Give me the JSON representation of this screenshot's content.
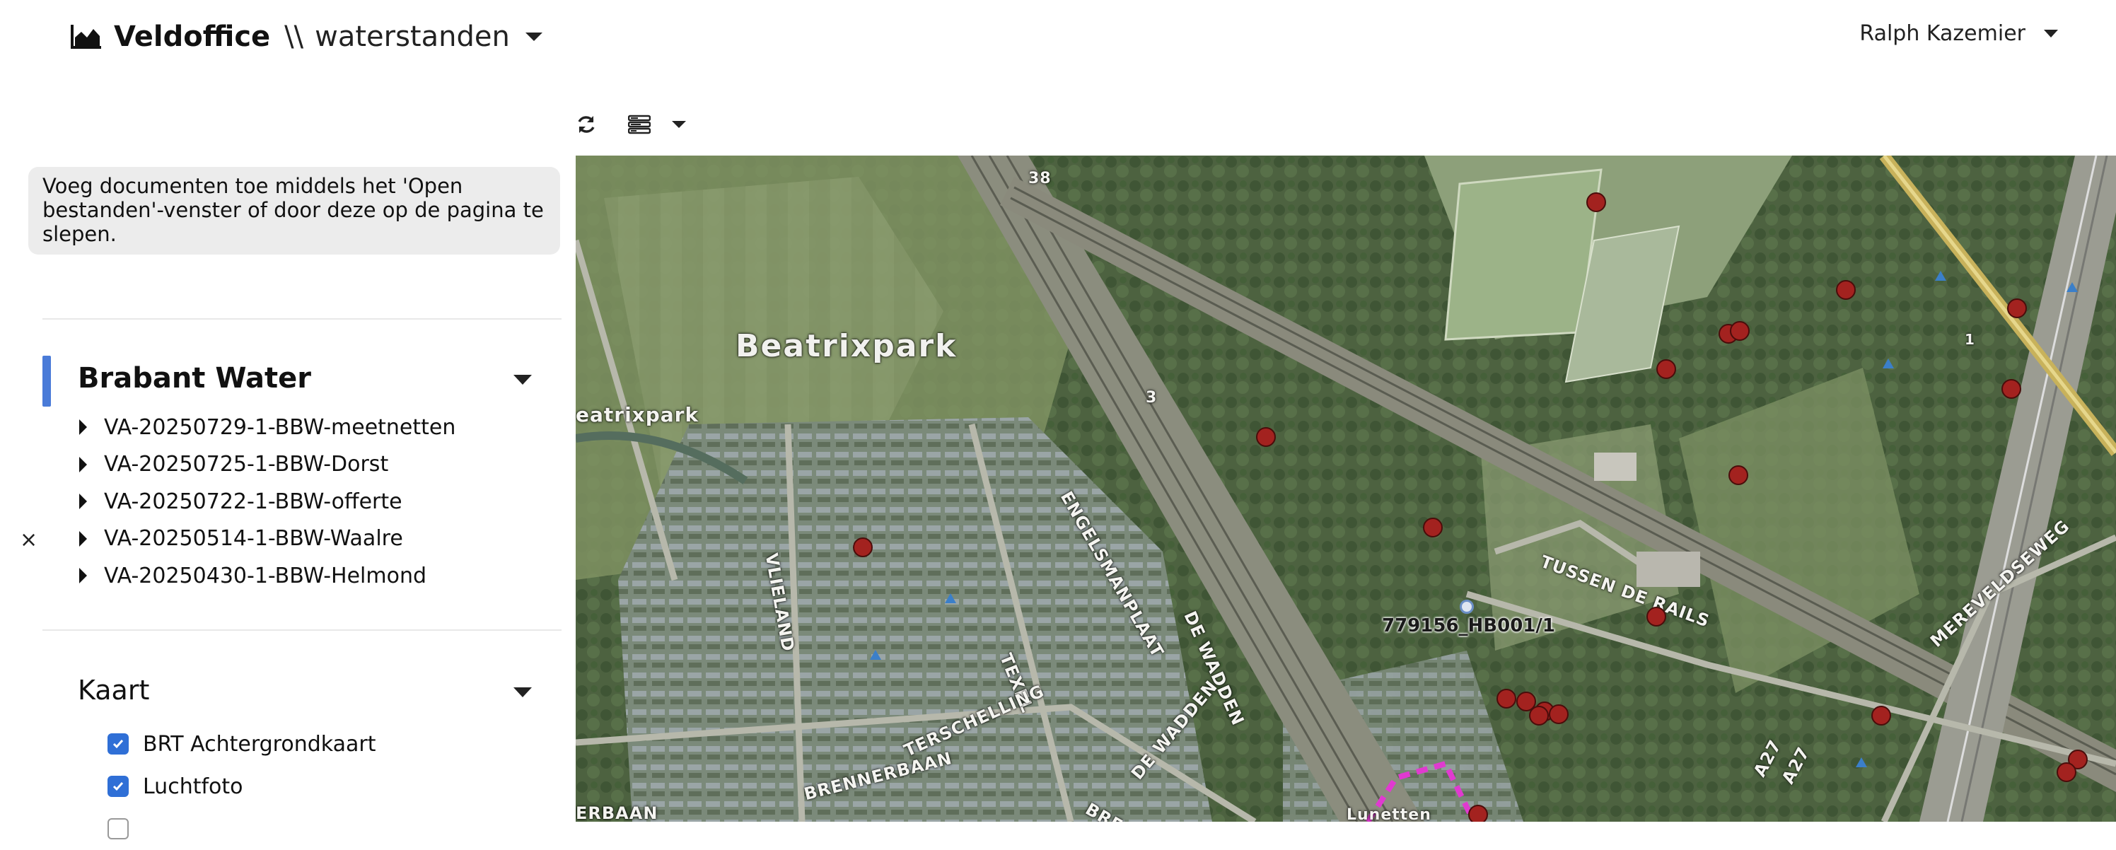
{
  "header": {
    "app_name": "Veldoffice",
    "separator": "\\\\",
    "section": "waterstanden",
    "user_name": "Ralph Kazemier"
  },
  "toolbar": {
    "refresh_icon": "refresh-icon",
    "layers_icon": "layers-icon"
  },
  "sidebar": {
    "info": "Voeg documenten toe middels het 'Open bestanden'-venster of door deze op de pagina te slepen.",
    "group_title": "Brabant Water",
    "documents": [
      "VA-20250729-1-BBW-meetnetten",
      "VA-20250725-1-BBW-Dorst",
      "VA-20250722-1-BBW-offerte",
      "VA-20250514-1-BBW-Waalre",
      "VA-20250430-1-BBW-Helmond"
    ],
    "close_symbol": "×",
    "map_section_title": "Kaart",
    "layers": [
      {
        "label": "BRT Achtergrondkaart",
        "checked": true
      },
      {
        "label": "Luchtfoto",
        "checked": true
      }
    ]
  },
  "map": {
    "place_labels": [
      "Beatrixpark",
      "eatrixpark"
    ],
    "street_labels": [
      "VLIELAND",
      "ENGELSMANPLAAT",
      "TEXEL",
      "TUSSEN DE RAILS",
      "MEREVELDSEWEG",
      "DE WADDEN",
      "TERSCHELLING",
      "BRENNERBAAN",
      "DE WADDEN",
      "A27",
      "A27",
      "Lunetten",
      "ERBAAN",
      "BREN"
    ],
    "road_numbers": [
      "38",
      "3",
      "1"
    ],
    "selected_point_label": "779156_HB001/1",
    "accent_marker_color": "#a3221f"
  }
}
